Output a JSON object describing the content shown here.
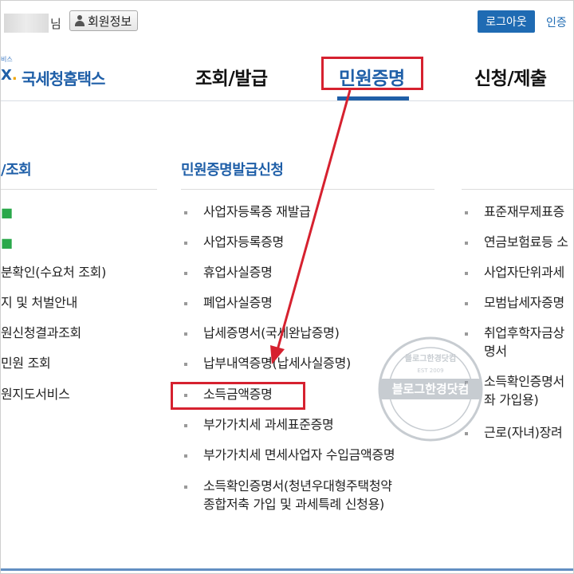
{
  "topbar": {
    "user_suffix": "님",
    "member_info_label": "회원정보",
    "logout_label": "로그아웃",
    "auth_label": "인증"
  },
  "logo": {
    "small_text": "비스",
    "mark": "X",
    "name": "국세청홈택스"
  },
  "nav": {
    "items": [
      {
        "label": "조회/발급"
      },
      {
        "label": "민원증명"
      },
      {
        "label": "신청/제출"
      }
    ],
    "active_index": 1
  },
  "menu": {
    "left_column": {
      "heading": "/조회",
      "items": [
        "",
        "",
        "분확인(수요처 조회)",
        "지 및 처벌안내",
        "원신청결과조회",
        "민원 조회",
        "원지도서비스"
      ]
    },
    "center_column": {
      "heading": "민원증명발급신청",
      "items": [
        "사업자등록증 재발급",
        "사업자등록증명",
        "휴업사실증명",
        "폐업사실증명",
        "납세증명서(국세완납증명)",
        "납부내역증명(납세사실증명)",
        "소득금액증명",
        "부가가치세 과세표준증명",
        "부가가치세 면세사업자 수입금액증명"
      ],
      "last_item_line1": "소득확인증명서(청년우대형주택청약",
      "last_item_line2": "종합저축 가입 및 과세특례 신청용)"
    },
    "right_column": {
      "items": [
        "표준재무제표증",
        "연금보험료등 소",
        "사업자단위과세",
        "모범납세자증명",
        "취업후학자금상",
        "명서",
        "소득확인증명서",
        "좌 가입용)",
        "근로(자녀)장려"
      ]
    }
  },
  "watermark": {
    "text": "블로그한경닷컴",
    "top_text": "블로그한경닷컴",
    "est": "EST 2009"
  },
  "colors": {
    "brand_blue": "#1f5fa8",
    "highlight_red": "#d6212f"
  }
}
